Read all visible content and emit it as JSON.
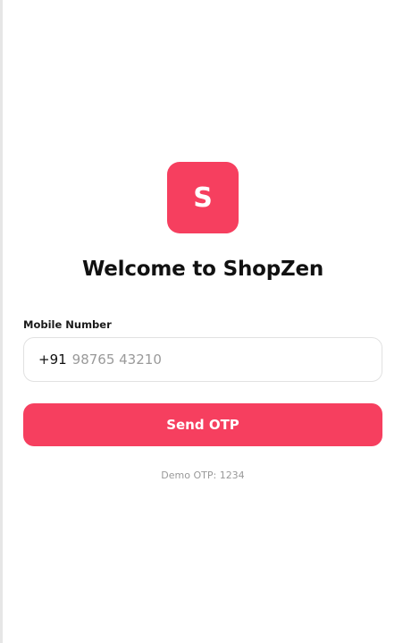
{
  "logo": {
    "letter": "S",
    "color": "#f63f5f"
  },
  "title": "Welcome to ShopZen",
  "form": {
    "mobile_label": "Mobile Number",
    "country_code": "+91",
    "mobile_placeholder": "98765 43210",
    "mobile_value": ""
  },
  "actions": {
    "send_otp_label": "Send OTP",
    "accent_color": "#f63f5f"
  },
  "hint": "Demo OTP: 1234"
}
